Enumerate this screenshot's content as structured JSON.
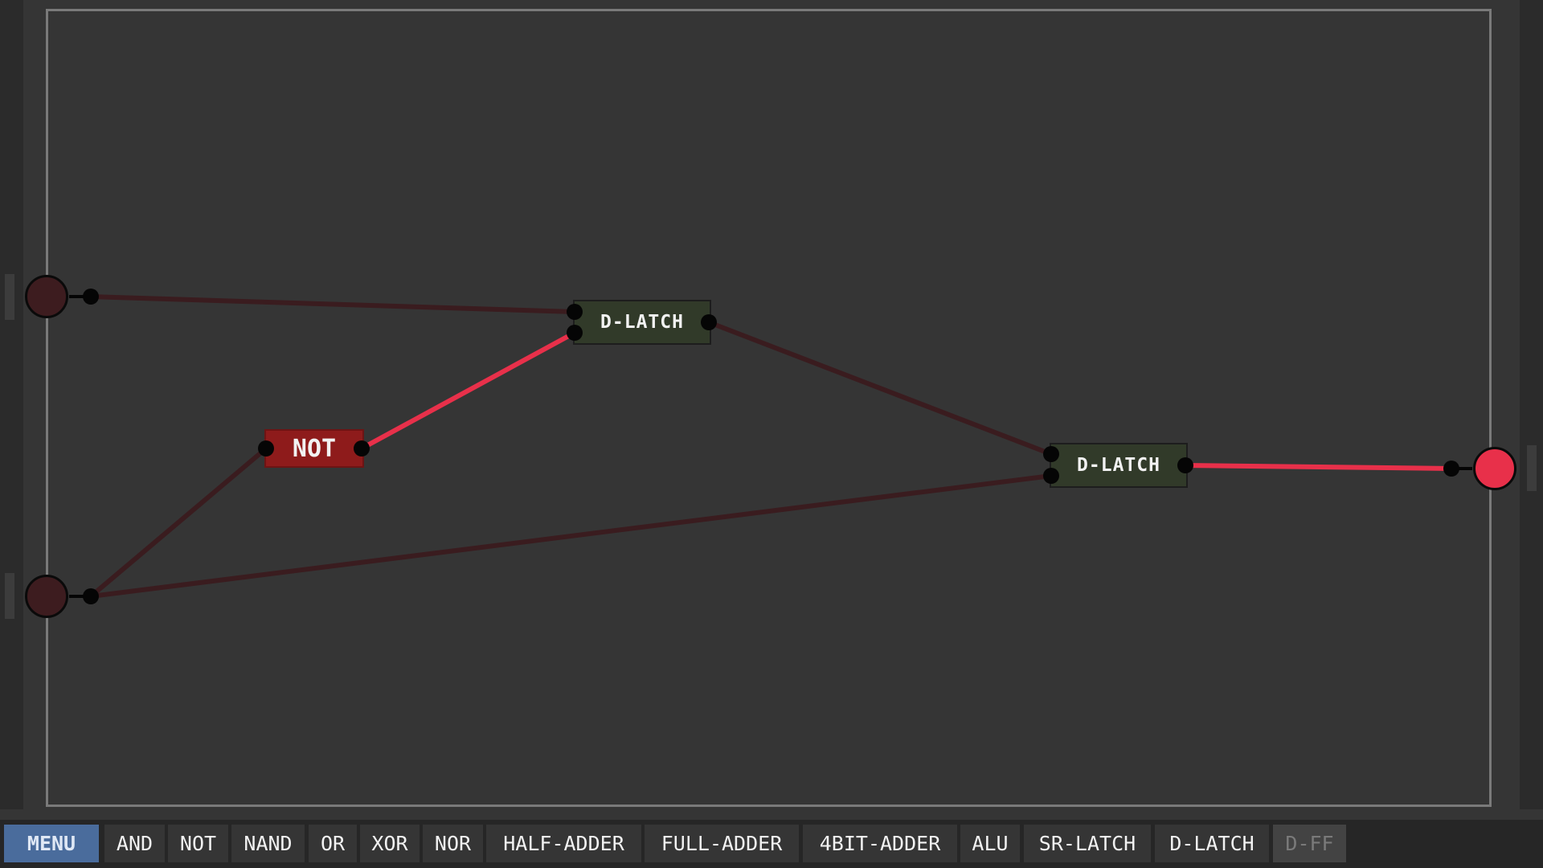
{
  "colors": {
    "background": "#353535",
    "wire_off": "#3a1c1f",
    "wire_on": "#e8304a",
    "latch_fill": "#313a29",
    "not_fill": "#8e1b1b",
    "menu_button": "#4a6c9c"
  },
  "circuit": {
    "chips": [
      {
        "id": "dlatch1",
        "label": "D-LATCH",
        "type": "latch"
      },
      {
        "id": "not1",
        "label": "NOT",
        "type": "not"
      },
      {
        "id": "dlatch2",
        "label": "D-LATCH",
        "type": "latch"
      }
    ],
    "inputs": [
      {
        "id": "in1",
        "state": "off"
      },
      {
        "id": "in2",
        "state": "off"
      }
    ],
    "outputs": [
      {
        "id": "out1",
        "state": "on"
      }
    ]
  },
  "toolbar": {
    "menu_label": "MENU",
    "items": [
      {
        "label": "AND",
        "enabled": true
      },
      {
        "label": "NOT",
        "enabled": true
      },
      {
        "label": "NAND",
        "enabled": true
      },
      {
        "label": "OR",
        "enabled": true
      },
      {
        "label": "XOR",
        "enabled": true
      },
      {
        "label": "NOR",
        "enabled": true
      },
      {
        "label": "HALF-ADDER",
        "enabled": true
      },
      {
        "label": "FULL-ADDER",
        "enabled": true
      },
      {
        "label": "4BIT-ADDER",
        "enabled": true
      },
      {
        "label": "ALU",
        "enabled": true
      },
      {
        "label": "SR-LATCH",
        "enabled": true
      },
      {
        "label": "D-LATCH",
        "enabled": true
      },
      {
        "label": "D-FF",
        "enabled": false
      }
    ]
  }
}
